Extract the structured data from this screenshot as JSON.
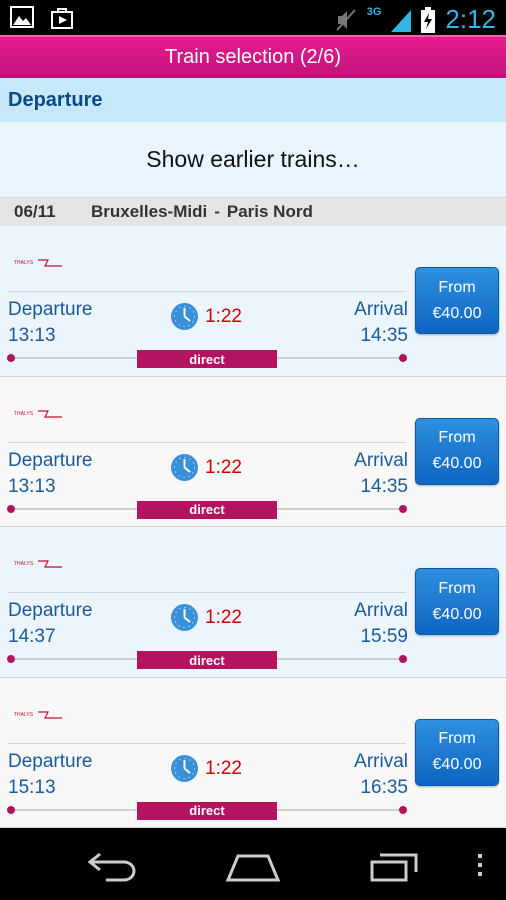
{
  "status_bar": {
    "time": "2:12",
    "network": "3G",
    "icons": [
      "image-icon",
      "play-store-icon",
      "mute-icon",
      "signal-icon",
      "battery-charging-icon"
    ]
  },
  "app_bar": {
    "title": "Train selection (2/6)"
  },
  "section": {
    "title": "Departure"
  },
  "earlier_trains": {
    "label": "Show earlier trains…"
  },
  "route": {
    "date": "06/11",
    "from": "Bruxelles-Midi",
    "separator": "-",
    "to": "Paris Nord"
  },
  "trains": [
    {
      "operator": "THALYS",
      "departure_label": "Departure",
      "departure_time": "13:13",
      "arrival_label": "Arrival",
      "arrival_time": "14:35",
      "duration": "1:22",
      "type": "direct",
      "price_label": "From",
      "price": "€40.00"
    },
    {
      "operator": "THALYS",
      "departure_label": "Departure",
      "departure_time": "13:13",
      "arrival_label": "Arrival",
      "arrival_time": "14:35",
      "duration": "1:22",
      "type": "direct",
      "price_label": "From",
      "price": "€40.00"
    },
    {
      "operator": "THALYS",
      "departure_label": "Departure",
      "departure_time": "14:37",
      "arrival_label": "Arrival",
      "arrival_time": "15:59",
      "duration": "1:22",
      "type": "direct",
      "price_label": "From",
      "price": "€40.00"
    },
    {
      "operator": "THALYS",
      "departure_label": "Departure",
      "departure_time": "15:13",
      "arrival_label": "Arrival",
      "arrival_time": "16:35",
      "duration": "1:22",
      "type": "direct",
      "price_label": "From",
      "price": "€40.00"
    }
  ],
  "nav_bar": {
    "icons": [
      "back-icon",
      "home-icon",
      "recent-apps-icon",
      "menu-icon"
    ]
  },
  "colors": {
    "accent": "#e61c8e",
    "header_bg": "#c7e7fb",
    "button_blue": "#1a78d0",
    "badge": "#b3135f",
    "duration": "#cc0000"
  }
}
